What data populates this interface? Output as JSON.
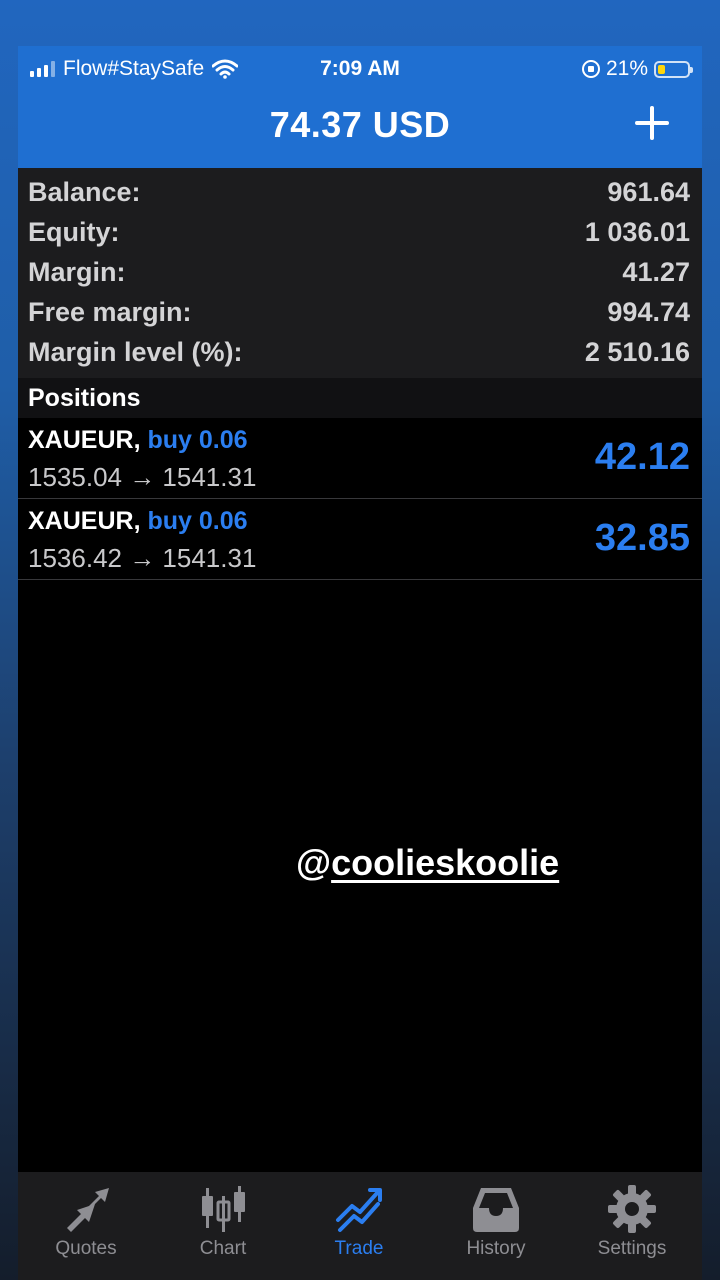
{
  "status_bar": {
    "carrier": "Flow#StaySafe",
    "time": "7:09 AM",
    "battery": "21%"
  },
  "header": {
    "title": "74.37 USD"
  },
  "summary": [
    {
      "label": "Balance:",
      "value": "961.64"
    },
    {
      "label": "Equity:",
      "value": "1 036.01"
    },
    {
      "label": "Margin:",
      "value": "41.27"
    },
    {
      "label": "Free margin:",
      "value": "994.74"
    },
    {
      "label": "Margin level (%):",
      "value": "2 510.16"
    }
  ],
  "positions": {
    "title": "Positions",
    "items": [
      {
        "symbol": "XAUEUR,",
        "side": "buy 0.06",
        "prices": "1535.04 → 1541.31",
        "profit": "42.12"
      },
      {
        "symbol": "XAUEUR,",
        "side": "buy 0.06",
        "prices": "1536.42 → 1541.31",
        "profit": "32.85"
      }
    ]
  },
  "watermark": {
    "at": "@",
    "handle": "coolieskoolie"
  },
  "tabs": [
    {
      "label": "Quotes",
      "icon": "quotes-arrows-icon"
    },
    {
      "label": "Chart",
      "icon": "candlestick-chart-icon"
    },
    {
      "label": "Trade",
      "icon": "trade-trend-icon",
      "active": true
    },
    {
      "label": "History",
      "icon": "inbox-history-icon"
    },
    {
      "label": "Settings",
      "icon": "gear-icon"
    }
  ],
  "colors": {
    "accent": "#2b7ef0",
    "header": "#1f6fd1",
    "background": "#000000"
  }
}
